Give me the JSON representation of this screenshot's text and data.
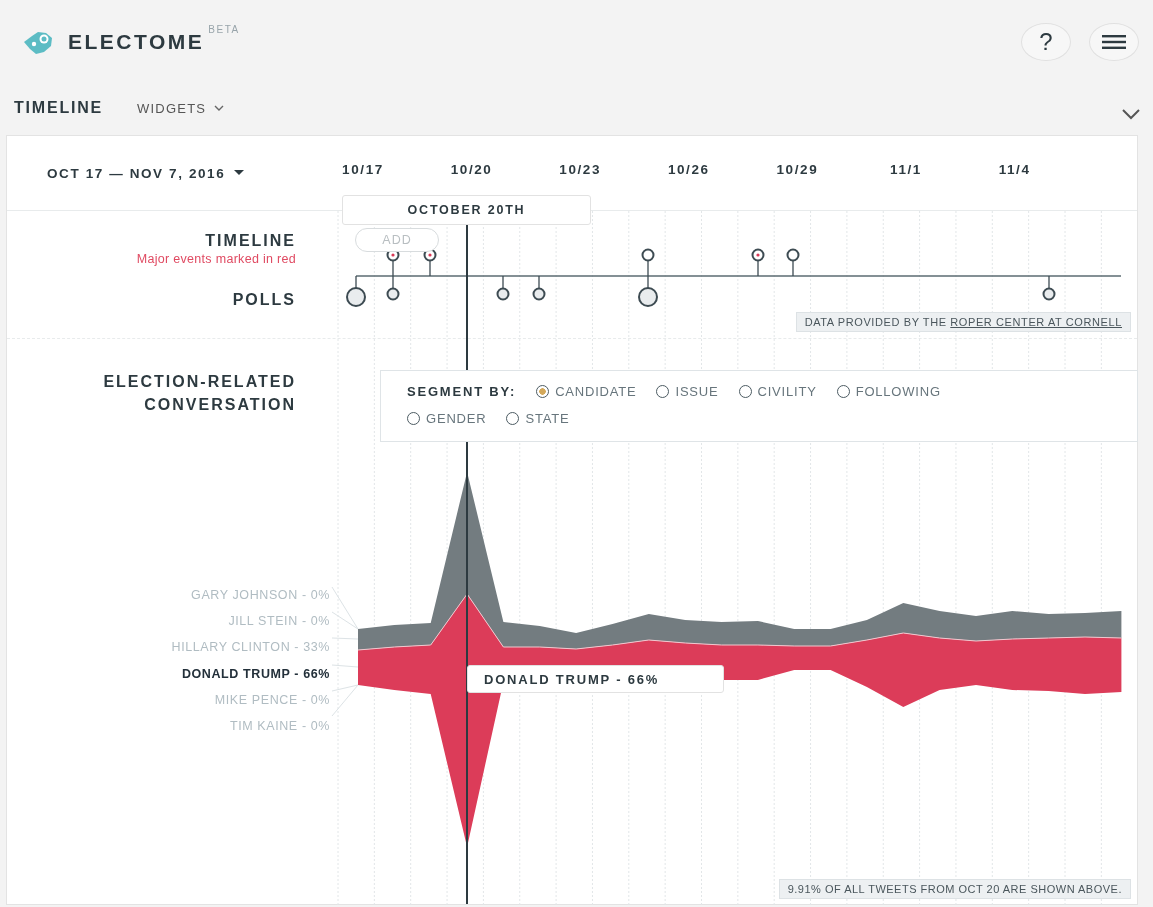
{
  "header": {
    "app_name": "ELECTOME",
    "badge": "BETA",
    "help_button": "?"
  },
  "nav": {
    "title": "TIMELINE",
    "widgets_menu": "WIDGETS"
  },
  "date_range": "OCT 17 — NOV 7, 2016",
  "date_axis": [
    "10/17",
    "10/20",
    "10/23",
    "10/26",
    "10/29",
    "11/1",
    "11/4"
  ],
  "cursor_label": "OCTOBER 20TH",
  "timeline": {
    "title": "TIMELINE",
    "subtitle": "Major events marked in red",
    "add_button": "ADD",
    "events": [
      {
        "major": true
      },
      {
        "major": true
      },
      {
        "major": false
      },
      {
        "major": true
      },
      {
        "major": false
      }
    ]
  },
  "polls": {
    "title": "POLLS",
    "markers": [
      {
        "large": true
      },
      {
        "large": false
      },
      {
        "large": false
      },
      {
        "large": false
      },
      {
        "large": true
      },
      {
        "large": false
      }
    ],
    "credit": "DATA PROVIDED BY THE",
    "credit_link": "ROPER CENTER AT CORNELL"
  },
  "conversation": {
    "title": "ELECTION-RELATED CONVERSATION",
    "segment_label": "SEGMENT BY:",
    "segments": [
      {
        "label": "CANDIDATE",
        "selected": true
      },
      {
        "label": "ISSUE",
        "selected": false
      },
      {
        "label": "CIVILITY",
        "selected": false
      },
      {
        "label": "FOLLOWING",
        "selected": false
      },
      {
        "label": "GENDER",
        "selected": false
      },
      {
        "label": "STATE",
        "selected": false
      }
    ],
    "candidates": [
      {
        "label": "GARY JOHNSON - 0%",
        "selected": false
      },
      {
        "label": "JILL STEIN - 0%",
        "selected": false
      },
      {
        "label": "HILLARY CLINTON - 33%",
        "selected": false
      },
      {
        "label": "DONALD TRUMP - 66%",
        "selected": true
      },
      {
        "label": "MIKE PENCE - 0%",
        "selected": false
      },
      {
        "label": "TIM KAINE - 0%",
        "selected": false
      }
    ],
    "tooltip": "DONALD TRUMP - 66%",
    "footnote": "9.91% OF ALL TWEETS FROM OCT 20 ARE SHOWN ABOVE."
  }
}
